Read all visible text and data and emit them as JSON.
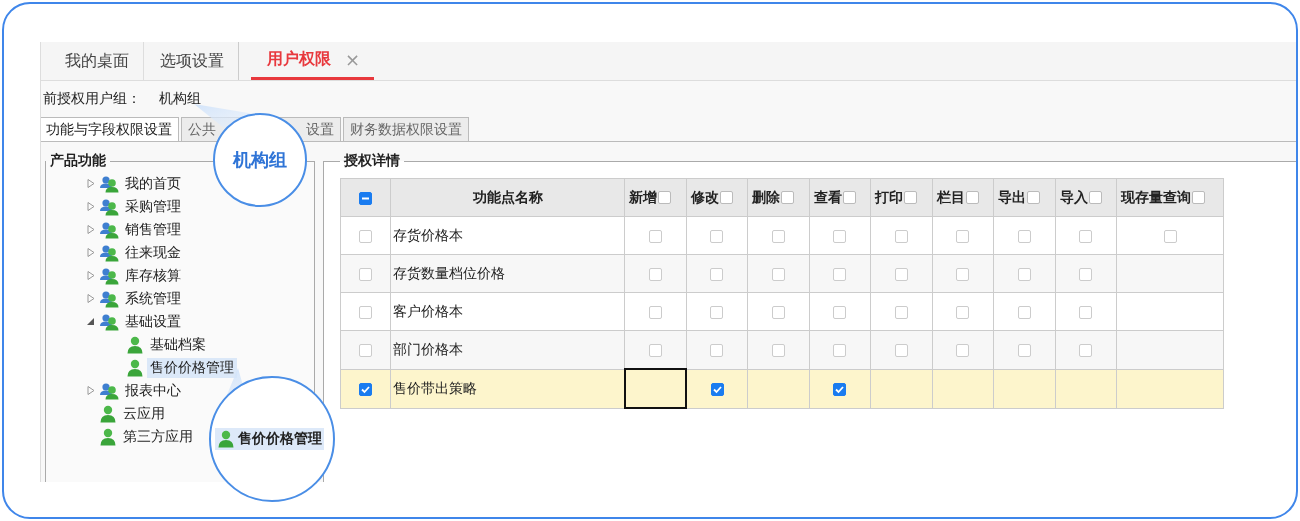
{
  "tabs": [
    {
      "label": "我的桌面",
      "selected": false,
      "closable": false
    },
    {
      "label": "选项设置",
      "selected": false,
      "closable": false
    },
    {
      "label": "用户权限",
      "selected": true,
      "closable": true,
      "close": "×"
    }
  ],
  "current_group": {
    "label": "前授权用户组：",
    "value": "机构组"
  },
  "subtabs": [
    {
      "label": "功能与字段权限设置",
      "selected": true
    },
    {
      "label": "公共",
      "label_after": "设置",
      "selected": false
    },
    {
      "label": "财务数据权限设置",
      "selected": false
    }
  ],
  "product_panel": {
    "title": "产品功能",
    "tree": [
      {
        "label": "我的首页",
        "kind": "group",
        "expanded": false,
        "selected": false
      },
      {
        "label": "采购管理",
        "kind": "group",
        "expanded": false,
        "selected": false
      },
      {
        "label": "销售管理",
        "kind": "group",
        "expanded": false,
        "selected": false
      },
      {
        "label": "往来现金",
        "kind": "group",
        "expanded": false,
        "selected": false
      },
      {
        "label": "库存核算",
        "kind": "group",
        "expanded": false,
        "selected": false
      },
      {
        "label": "系统管理",
        "kind": "group",
        "expanded": false,
        "selected": false
      },
      {
        "label": "基础设置",
        "kind": "group",
        "expanded": true,
        "selected": false,
        "children": [
          {
            "label": "基础档案",
            "kind": "user",
            "selected": false
          },
          {
            "label": "售价价格管理",
            "kind": "user",
            "selected": true
          }
        ]
      },
      {
        "label": "报表中心",
        "kind": "group",
        "expanded": false,
        "selected": false
      },
      {
        "label": "云应用",
        "kind": "user",
        "selected": false
      },
      {
        "label": "第三方应用",
        "kind": "user",
        "selected": false
      }
    ]
  },
  "detail_panel": {
    "title": "授权详情",
    "header_check": {
      "indeterminate": true
    },
    "columns": [
      {
        "label": "功能点名称",
        "kind": "name"
      },
      {
        "label": "新增",
        "kind": "check",
        "checked": false
      },
      {
        "label": "修改",
        "kind": "check",
        "checked": false
      },
      {
        "label": "删除",
        "kind": "check",
        "checked": false
      },
      {
        "label": "查看",
        "kind": "check",
        "checked": false
      },
      {
        "label": "打印",
        "kind": "check",
        "checked": false
      },
      {
        "label": "栏目",
        "kind": "check",
        "checked": false
      },
      {
        "label": "导出",
        "kind": "check",
        "checked": false
      },
      {
        "label": "导入",
        "kind": "check",
        "checked": false
      },
      {
        "label": "现存量查询",
        "kind": "check",
        "checked": false
      }
    ],
    "rows": [
      {
        "name": "存货价格本",
        "checked": false,
        "selected": false,
        "cells": [
          {
            "kind": "checkbox",
            "checked": false
          },
          {
            "kind": "checkbox",
            "checked": false
          },
          {
            "kind": "checkbox",
            "checked": false
          },
          {
            "kind": "checkbox",
            "checked": false
          },
          {
            "kind": "checkbox",
            "checked": false
          },
          {
            "kind": "checkbox",
            "checked": false
          },
          {
            "kind": "checkbox",
            "checked": false
          },
          {
            "kind": "checkbox",
            "checked": false
          },
          {
            "kind": "checkbox",
            "checked": false
          }
        ]
      },
      {
        "name": "存货数量档位价格",
        "checked": false,
        "selected": false,
        "cells": [
          {
            "kind": "checkbox",
            "checked": false
          },
          {
            "kind": "checkbox",
            "checked": false
          },
          {
            "kind": "checkbox",
            "checked": false
          },
          {
            "kind": "checkbox",
            "checked": false
          },
          {
            "kind": "checkbox",
            "checked": false
          },
          {
            "kind": "checkbox",
            "checked": false
          },
          {
            "kind": "checkbox",
            "checked": false
          },
          {
            "kind": "checkbox",
            "checked": false
          },
          {
            "kind": "blank"
          }
        ]
      },
      {
        "name": "客户价格本",
        "checked": false,
        "selected": false,
        "cells": [
          {
            "kind": "checkbox",
            "checked": false
          },
          {
            "kind": "checkbox",
            "checked": false
          },
          {
            "kind": "checkbox",
            "checked": false
          },
          {
            "kind": "checkbox",
            "checked": false
          },
          {
            "kind": "checkbox",
            "checked": false
          },
          {
            "kind": "checkbox",
            "checked": false
          },
          {
            "kind": "checkbox",
            "checked": false
          },
          {
            "kind": "checkbox",
            "checked": false
          },
          {
            "kind": "blank"
          }
        ]
      },
      {
        "name": "部门价格本",
        "checked": false,
        "selected": false,
        "cells": [
          {
            "kind": "checkbox",
            "checked": false
          },
          {
            "kind": "checkbox",
            "checked": false
          },
          {
            "kind": "checkbox",
            "checked": false
          },
          {
            "kind": "checkbox",
            "checked": false
          },
          {
            "kind": "checkbox",
            "checked": false
          },
          {
            "kind": "checkbox",
            "checked": false
          },
          {
            "kind": "checkbox",
            "checked": false
          },
          {
            "kind": "checkbox",
            "checked": false
          },
          {
            "kind": "blank"
          }
        ]
      },
      {
        "name": "售价带出策略",
        "checked": true,
        "selected": true,
        "cells": [
          {
            "kind": "focus"
          },
          {
            "kind": "checkbox",
            "checked": true
          },
          {
            "kind": "blank"
          },
          {
            "kind": "checkbox",
            "checked": true
          },
          {
            "kind": "blank"
          },
          {
            "kind": "blank"
          },
          {
            "kind": "blank"
          },
          {
            "kind": "blank"
          },
          {
            "kind": "blank"
          }
        ]
      }
    ]
  },
  "callouts": [
    {
      "kind": "text",
      "label": "机构组"
    },
    {
      "kind": "icon-text",
      "label": "售价价格管理"
    }
  ]
}
